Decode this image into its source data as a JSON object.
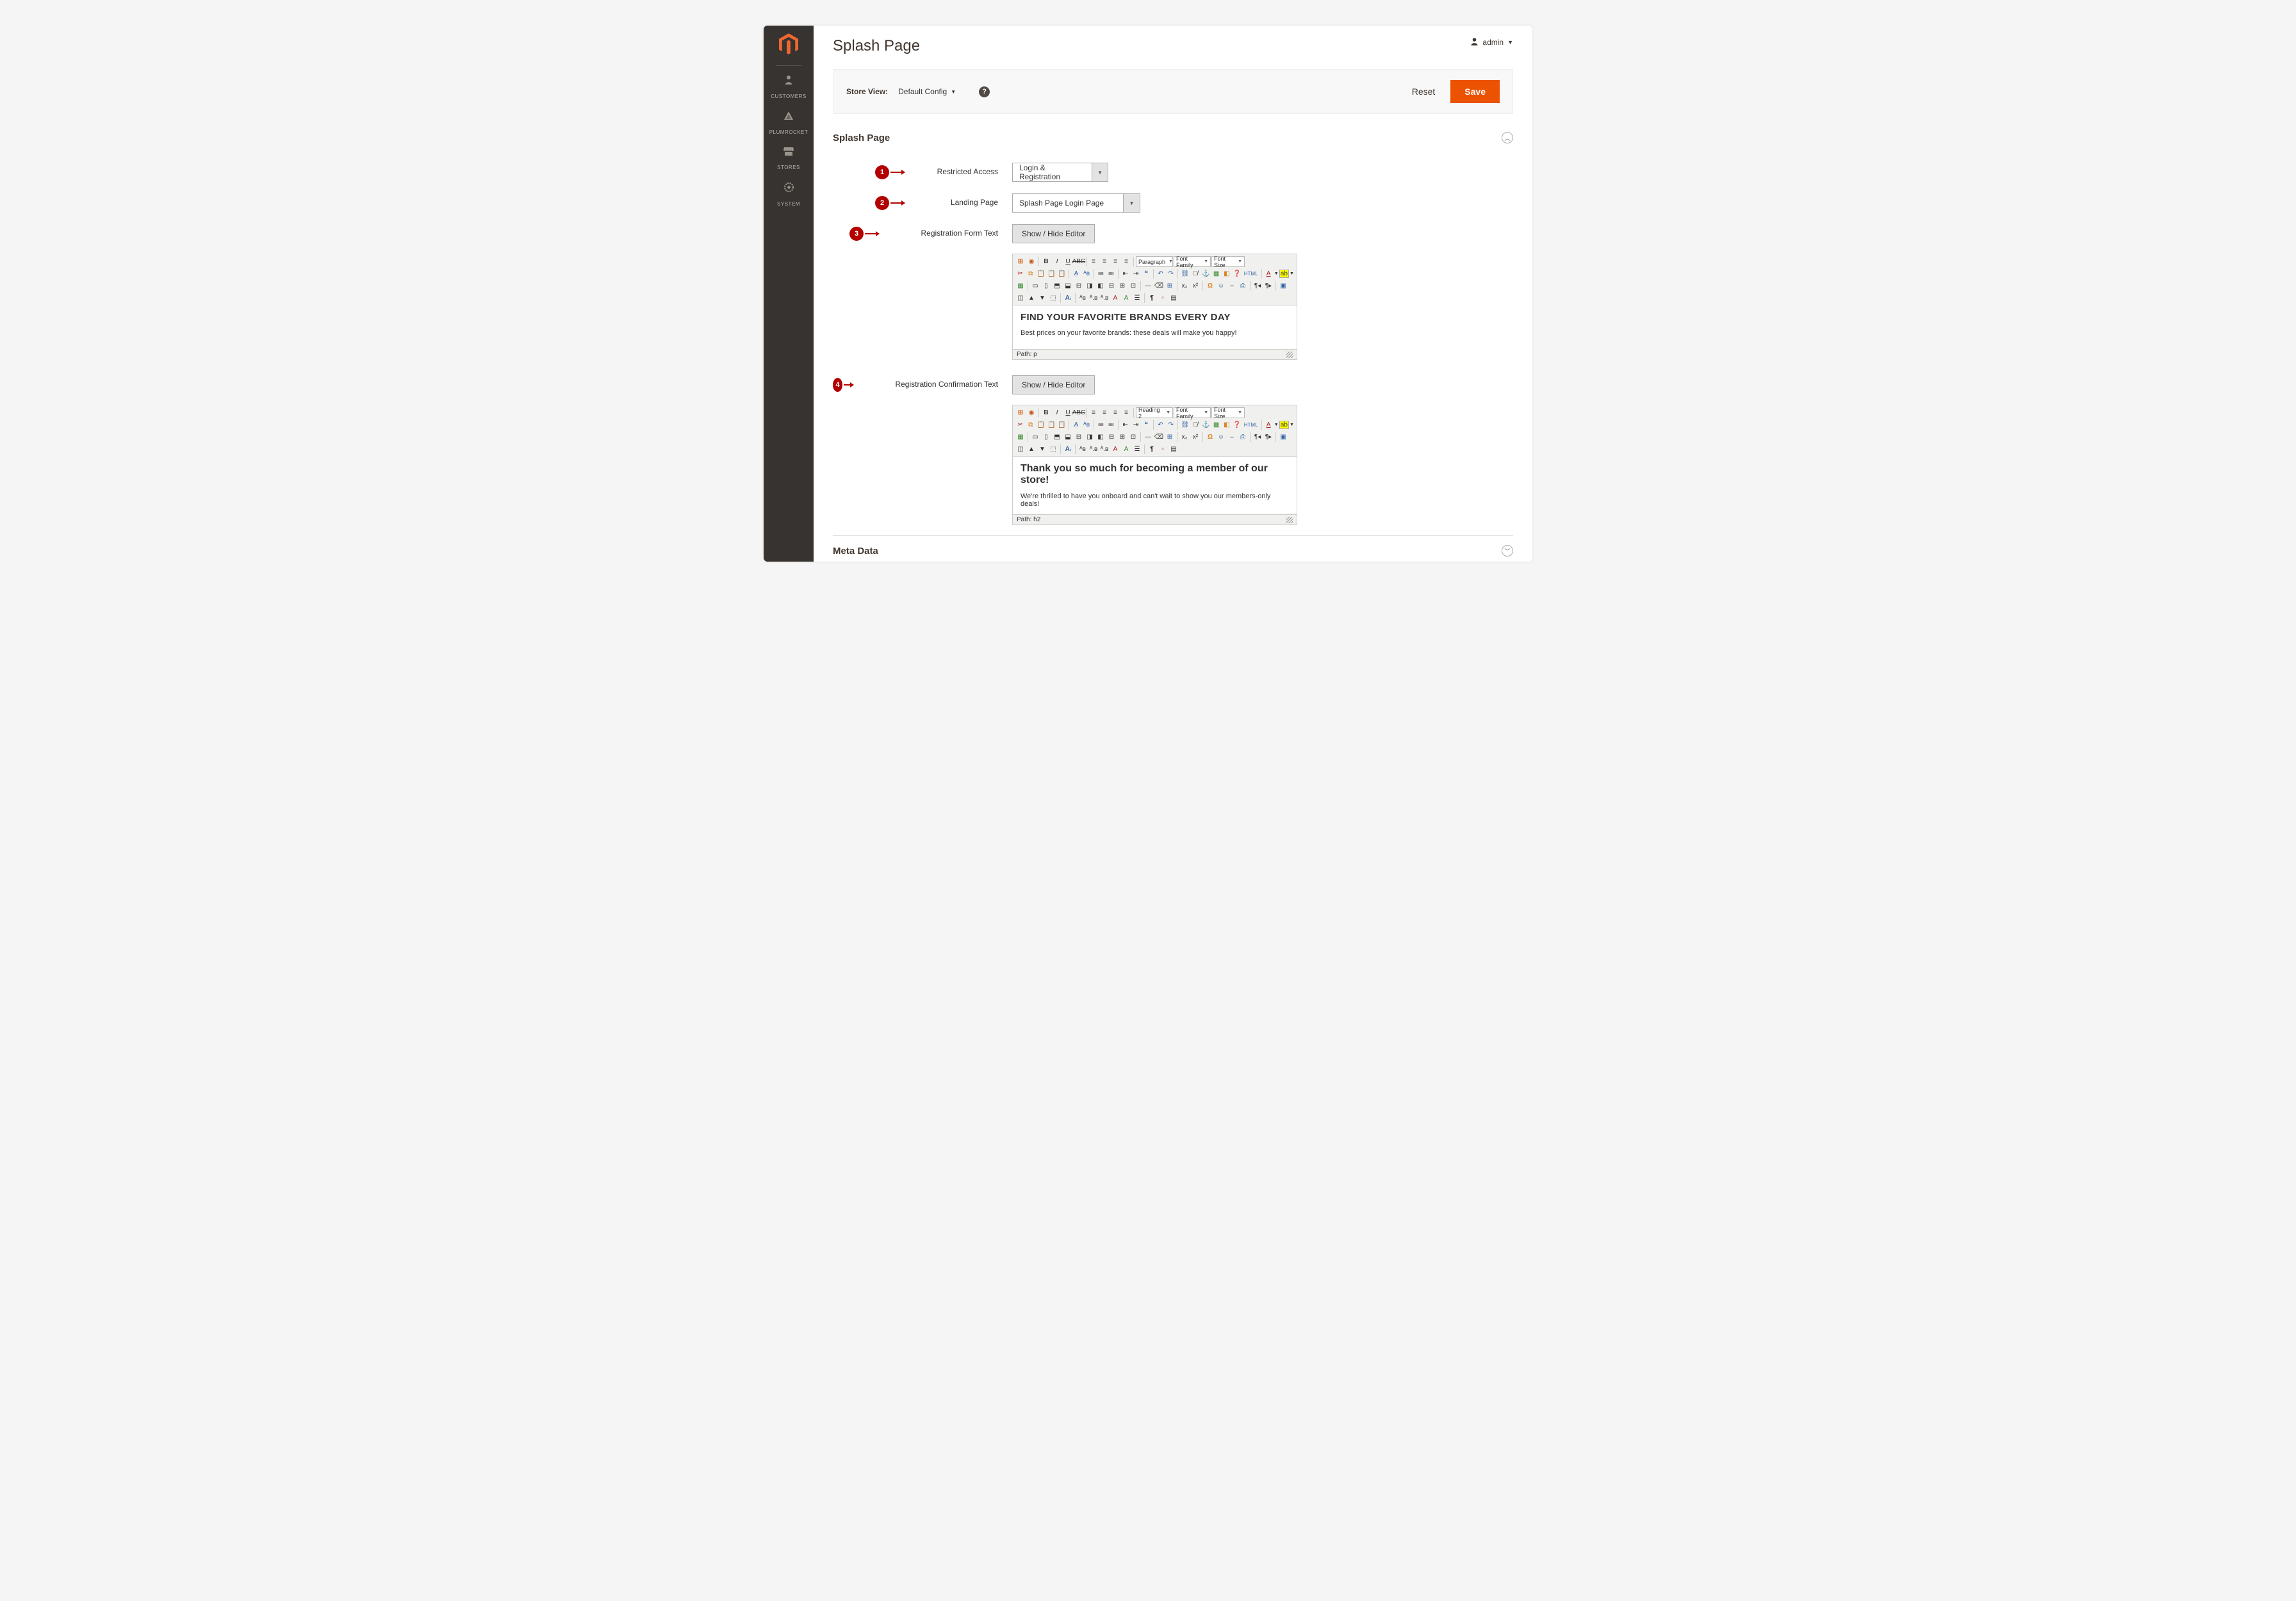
{
  "header": {
    "page_title": "Splash Page",
    "user_name": "admin"
  },
  "sidebar": {
    "items": [
      {
        "label": "CUSTOMERS"
      },
      {
        "label": "PLUMROCKET"
      },
      {
        "label": "STORES"
      },
      {
        "label": "SYSTEM"
      }
    ]
  },
  "action_bar": {
    "store_view_label": "Store View:",
    "store_view_value": "Default Config",
    "reset_label": "Reset",
    "save_label": "Save"
  },
  "sections": {
    "splash": {
      "title": "Splash Page"
    },
    "meta": {
      "title": "Meta Data"
    }
  },
  "fields": {
    "restricted_access": {
      "marker": "1",
      "label": "Restricted Access",
      "value": "Login & Registration"
    },
    "landing_page": {
      "marker": "2",
      "label": "Landing Page",
      "value": "Splash Page Login Page"
    },
    "reg_form_text": {
      "marker": "3",
      "label": "Registration Form Text",
      "toggle": "Show / Hide Editor",
      "format_value": "Paragraph",
      "font_family": "Font Family",
      "font_size": "Font Size",
      "heading": "FIND YOUR FAVORITE BRANDS EVERY DAY",
      "body": "Best prices on your favorite brands: these deals will make you happy!",
      "path_label": "Path:",
      "path_value": "p"
    },
    "reg_confirm_text": {
      "marker": "4",
      "label": "Registration Confirmation Text",
      "toggle": "Show / Hide Editor",
      "format_value": "Heading 2",
      "font_family": "Font Family",
      "font_size": "Font Size",
      "heading": "Thank you so much for becoming a member of our store!",
      "body": "We're thrilled to have you onboard and can't wait to show you our members-only deals!",
      "path_label": "Path:",
      "path_value": "h2"
    }
  },
  "editor_misc": {
    "html_label": "HTML"
  }
}
